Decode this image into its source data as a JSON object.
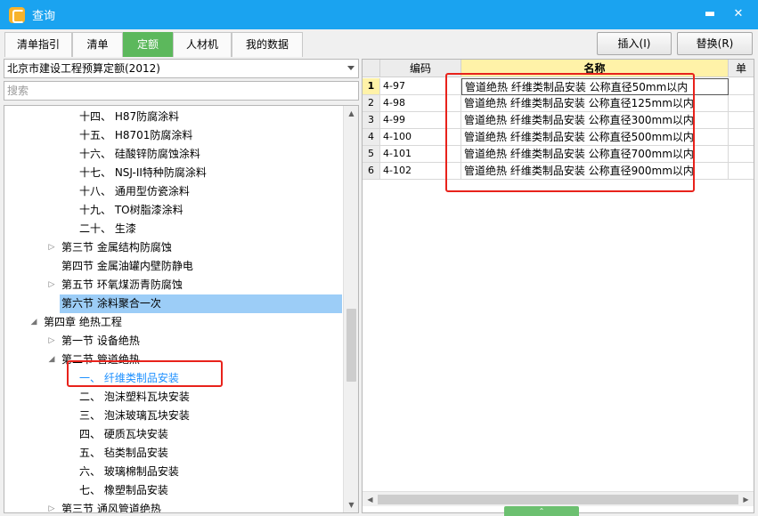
{
  "window": {
    "title": "查询"
  },
  "tabs": [
    {
      "label": "清单指引"
    },
    {
      "label": "清单"
    },
    {
      "label": "定额"
    },
    {
      "label": "人材机"
    },
    {
      "label": "我的数据"
    }
  ],
  "buttons": {
    "insert": "插入(I)",
    "replace": "替换(R)"
  },
  "left": {
    "library": "北京市建设工程预算定额(2012)",
    "search_placeholder": "搜索",
    "tree": [
      {
        "label": "十四、 H87防腐涂料"
      },
      {
        "label": "十五、 H8701防腐涂料"
      },
      {
        "label": "十六、 硅酸锌防腐蚀涂料"
      },
      {
        "label": "十七、 NSJ-II特种防腐涂料"
      },
      {
        "label": "十八、 通用型仿瓷涂料"
      },
      {
        "label": "十九、 TO树脂漆涂料"
      },
      {
        "label": "二十、 生漆"
      },
      {
        "label": "第三节 金属结构防腐蚀"
      },
      {
        "label": "第四节 金属油罐内壁防静电"
      },
      {
        "label": "第五节 环氧煤沥青防腐蚀"
      },
      {
        "label": "第六节 涂料聚合一次"
      },
      {
        "label": "第四章 绝热工程"
      },
      {
        "label": "第一节 设备绝热"
      },
      {
        "label": "第二节 管道绝热"
      },
      {
        "label": "一、 纤维类制品安装"
      },
      {
        "label": "二、 泡沫塑料瓦块安装"
      },
      {
        "label": "三、 泡沫玻璃瓦块安装"
      },
      {
        "label": "四、 硬质瓦块安装"
      },
      {
        "label": "五、 毡类制品安装"
      },
      {
        "label": "六、 玻璃棉制品安装"
      },
      {
        "label": "七、 橡塑制品安装"
      },
      {
        "label": "第三节 通风管道绝热"
      }
    ]
  },
  "grid": {
    "headers": {
      "code": "编码",
      "name": "名称",
      "unit": "单"
    },
    "rows": [
      {
        "num": "1",
        "code": "4-97",
        "name": "管道绝热 纤维类制品安装 公称直径50mm以内"
      },
      {
        "num": "2",
        "code": "4-98",
        "name": "管道绝热 纤维类制品安装 公称直径125mm以内"
      },
      {
        "num": "3",
        "code": "4-99",
        "name": "管道绝热 纤维类制品安装 公称直径300mm以内"
      },
      {
        "num": "4",
        "code": "4-100",
        "name": "管道绝热 纤维类制品安装 公称直径500mm以内"
      },
      {
        "num": "5",
        "code": "4-101",
        "name": "管道绝热 纤维类制品安装 公称直径700mm以内"
      },
      {
        "num": "6",
        "code": "4-102",
        "name": "管道绝热 纤维类制品安装 公称直径900mm以内"
      }
    ]
  },
  "colors": {
    "titlebar": "#1aa3f0",
    "active_tab": "#5cb85c",
    "selected_row": "#9ccdf7",
    "current_item": "#1e90ff",
    "annotation": "#e8221b",
    "grid_highlight": "#fff2a8"
  },
  "icons": {
    "app": "app-logo-icon",
    "minimize": "minimize-icon",
    "close": "close-icon",
    "dropdown": "chevron-down-icon",
    "expand": "triangle-right-icon",
    "collapse": "triangle-down-icon"
  }
}
